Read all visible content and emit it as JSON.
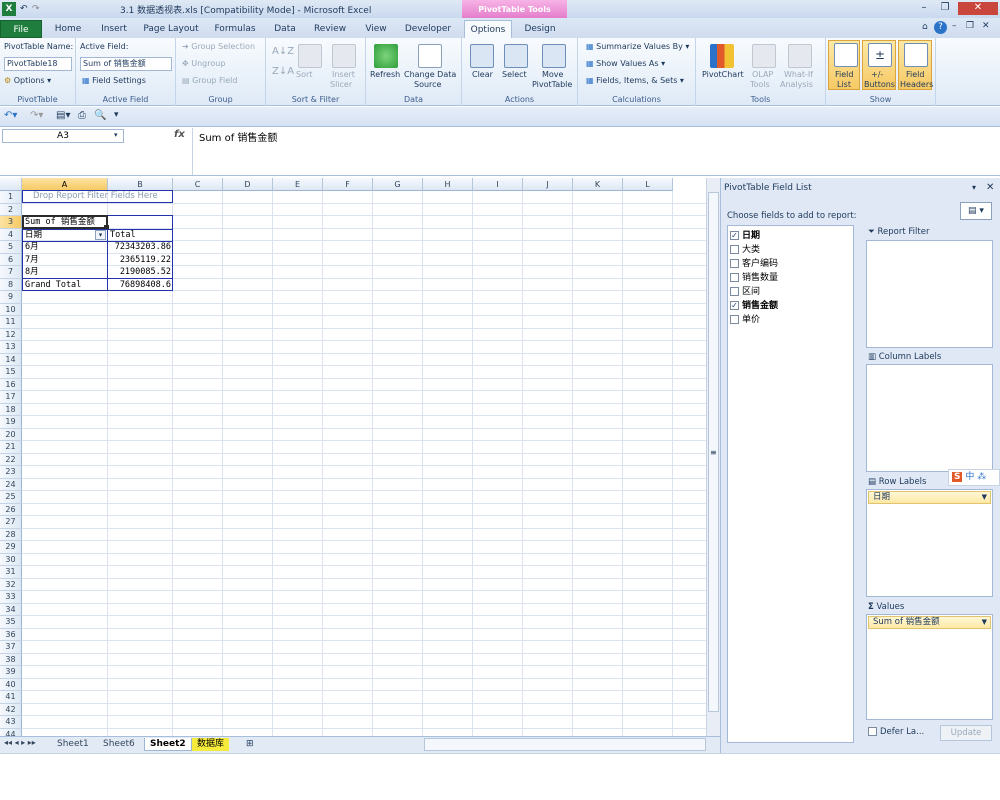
{
  "window": {
    "title": "3.1 数据透视表.xls  [Compatibility Mode]  -  Microsoft Excel",
    "context_tab": "PivotTable Tools"
  },
  "ribbon_tabs": [
    "File",
    "Home",
    "Insert",
    "Page Layout",
    "Formulas",
    "Data",
    "Review",
    "View",
    "Developer",
    "Options",
    "Design"
  ],
  "ribbon": {
    "pivottable": {
      "name_label": "PivotTable Name:",
      "name_value": "PivotTable18",
      "options": "Options",
      "group": "PivotTable"
    },
    "active_field": {
      "label": "Active Field:",
      "value": "Sum of 销售金额",
      "settings": "Field Settings",
      "group": "Active Field"
    },
    "group": {
      "selection": "Group Selection",
      "ungroup": "Ungroup",
      "field": "Group Field",
      "group": "Group"
    },
    "sort": {
      "sort": "Sort",
      "group": "Sort & Filter",
      "insert": "Insert",
      "slicer": "Slicer"
    },
    "data": {
      "refresh": "Refresh",
      "change": "Change Data",
      "source": "Source",
      "group": "Data"
    },
    "actions": {
      "clear": "Clear",
      "select": "Select",
      "move": "Move",
      "pivottable": "PivotTable",
      "group": "Actions"
    },
    "calc": {
      "summarize": "Summarize Values By",
      "show": "Show Values As",
      "fields": "Fields, Items, & Sets",
      "group": "Calculations"
    },
    "tools": {
      "chart": "PivotChart",
      "olap": "OLAP",
      "olap2": "Tools",
      "whatif": "What-If",
      "whatif2": "Analysis",
      "group": "Tools"
    },
    "show": {
      "fieldlist": "Field",
      "fieldlist2": "List",
      "buttons": "+/-",
      "buttons2": "Buttons",
      "headers": "Field",
      "headers2": "Headers",
      "group": "Show"
    }
  },
  "namebox": "A3",
  "formula": "Sum of 销售金额",
  "columns": [
    "A",
    "B",
    "C",
    "D",
    "E",
    "F",
    "G",
    "H",
    "I",
    "J",
    "K",
    "L"
  ],
  "rows": [
    "1",
    "2",
    "3",
    "4",
    "5",
    "6",
    "7",
    "8",
    "9",
    "10",
    "11",
    "12",
    "13",
    "14",
    "15",
    "16",
    "17",
    "18",
    "19",
    "20",
    "21",
    "22",
    "23",
    "24",
    "25",
    "26",
    "27",
    "28",
    "29",
    "30",
    "31",
    "32",
    "33",
    "34",
    "35",
    "36",
    "37",
    "38",
    "39",
    "40",
    "41",
    "42",
    "43",
    "44"
  ],
  "pivot": {
    "filter_drop": "Drop Report Filter Fields Here",
    "header_a": "Sum of 销售金额",
    "row_label": "日期",
    "col_total": "Total",
    "data": [
      {
        "label": "6月",
        "value": "72343203.86"
      },
      {
        "label": "7月",
        "value": "2365119.22"
      },
      {
        "label": "8月",
        "value": "2190085.52"
      }
    ],
    "grand_label": "Grand Total",
    "grand_value": "76898408.6"
  },
  "sheets": [
    "Sheet1",
    "Sheet6",
    "Sheet2",
    "数据库"
  ],
  "active_sheet": "Sheet2",
  "fieldlist": {
    "title": "PivotTable Field List",
    "choose": "Choose fields to add to report:",
    "fields": [
      {
        "name": "日期",
        "checked": true
      },
      {
        "name": "大类",
        "checked": false
      },
      {
        "name": "客户编码",
        "checked": false
      },
      {
        "name": "销售数量",
        "checked": false
      },
      {
        "name": "区间",
        "checked": false
      },
      {
        "name": "销售金额",
        "checked": true
      },
      {
        "name": "单价",
        "checked": false
      }
    ],
    "report_filter": "Report Filter",
    "column_labels": "Column Labels",
    "row_labels": "Row Labels",
    "values": "Values",
    "row_chip": "日期",
    "value_chip": "Sum of 销售金额",
    "defer": "Defer La...",
    "update": "Update"
  },
  "colors": {
    "accent": "#1f7d3e",
    "context": "#e277c8",
    "pivot_border": "#2233aa",
    "highlight": "#f6c964"
  }
}
